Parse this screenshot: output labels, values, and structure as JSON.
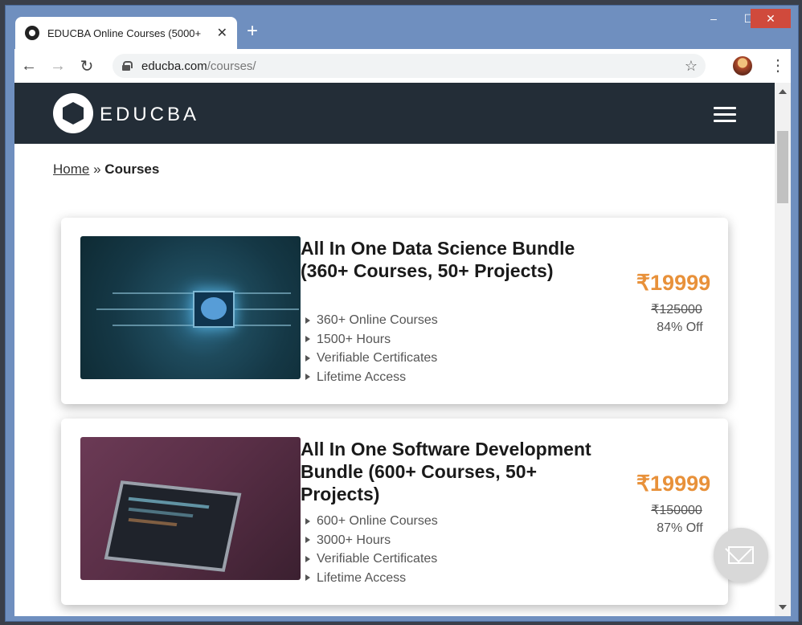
{
  "browser": {
    "tab_title": "EDUCBA Online Courses (5000+",
    "tab_close": "✕",
    "new_tab": "+",
    "controls": {
      "minimize": "–",
      "maximize": "☐",
      "close": "✕"
    },
    "nav": {
      "back": "←",
      "forward": "→",
      "reload": "↻"
    },
    "url_host": "educba.com",
    "url_path": "/courses/",
    "star": "☆",
    "menu": "⋮"
  },
  "site": {
    "logo_text": "EDUCBA",
    "breadcrumb": {
      "home": "Home",
      "separator": "»",
      "current": "Courses"
    }
  },
  "courses": [
    {
      "title": "All In One Data Science Bundle (360+ Courses, 50+ Projects)",
      "features": [
        "360+ Online Courses",
        "1500+ Hours",
        "Verifiable Certificates",
        "Lifetime Access"
      ],
      "price": "₹19999",
      "original_price": "₹125000",
      "discount": "84% Off"
    },
    {
      "title": "All In One Software Development Bundle (600+ Courses, 50+ Projects)",
      "features": [
        "600+ Online Courses",
        "3000+ Hours",
        "Verifiable Certificates",
        "Lifetime Access"
      ],
      "price": "₹19999",
      "original_price": "₹150000",
      "discount": "87% Off"
    }
  ],
  "colors": {
    "header_bg": "#232d37",
    "price_accent": "#e8913a",
    "window_frame": "#6f8fbf"
  }
}
